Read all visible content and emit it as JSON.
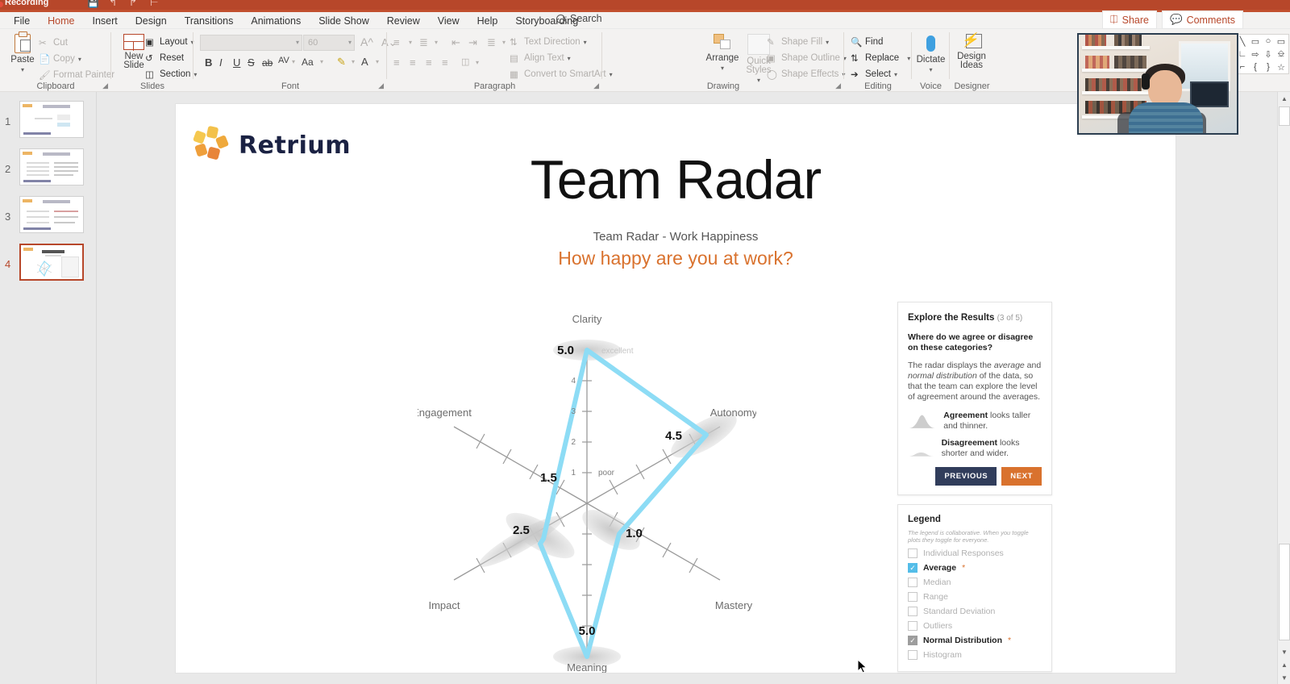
{
  "titlebar": {
    "recording_label": "Recording",
    "qat_icons": [
      "save-icon",
      "undo-icon",
      "redo-icon",
      "present-icon"
    ]
  },
  "ribbon": {
    "tabs": [
      {
        "label": "File",
        "active": false
      },
      {
        "label": "Home",
        "active": true
      },
      {
        "label": "Insert",
        "active": false
      },
      {
        "label": "Design",
        "active": false
      },
      {
        "label": "Transitions",
        "active": false
      },
      {
        "label": "Animations",
        "active": false
      },
      {
        "label": "Slide Show",
        "active": false
      },
      {
        "label": "Review",
        "active": false
      },
      {
        "label": "View",
        "active": false
      },
      {
        "label": "Help",
        "active": false
      },
      {
        "label": "Storyboarding",
        "active": false
      }
    ],
    "search_label": "Search",
    "share_label": "Share",
    "comments_label": "Comments",
    "groups": {
      "clipboard": {
        "name": "Clipboard",
        "paste": "Paste",
        "cut": "Cut",
        "copy": "Copy",
        "format_painter": "Format Painter"
      },
      "slides": {
        "name": "Slides",
        "new_slide_line1": "New",
        "new_slide_line2": "Slide",
        "layout": "Layout",
        "reset": "Reset",
        "section": "Section"
      },
      "font": {
        "name": "Font",
        "font_family_value": "",
        "font_size_value": "60",
        "bold": "B",
        "italic": "I",
        "underline": "U",
        "strikethrough": "S",
        "shadow": "ab",
        "spacing": "AV",
        "case": "Aa",
        "grow": "A",
        "shrink": "A",
        "clear": "A"
      },
      "paragraph": {
        "name": "Paragraph",
        "text_direction": "Text Direction",
        "align_text": "Align Text",
        "convert_smartart": "Convert to SmartArt"
      },
      "drawing": {
        "name": "Drawing",
        "arrange": "Arrange",
        "quick_styles_line1": "Quick",
        "quick_styles_line2": "Styles",
        "shape_fill": "Shape Fill",
        "shape_outline": "Shape Outline",
        "shape_effects": "Shape Effects",
        "shapes": [
          "A",
          "\\",
          "\\",
          "▭",
          "◯",
          "▢",
          "△",
          "⌐",
          "⌐",
          "⇨",
          "⇩",
          "⌒",
          "ℓ",
          "⌒",
          "⌒",
          "{",
          "}",
          "☆"
        ]
      },
      "editing": {
        "name": "Editing",
        "find": "Find",
        "replace": "Replace",
        "select": "Select"
      },
      "voice": {
        "name": "Voice",
        "dictate": "Dictate"
      },
      "designer": {
        "name": "Designer",
        "design_line1": "Design",
        "design_line2": "Ideas"
      }
    }
  },
  "thumbnails": [
    {
      "number": "1",
      "selected": false
    },
    {
      "number": "2",
      "selected": false
    },
    {
      "number": "3",
      "selected": false
    },
    {
      "number": "4",
      "selected": true
    }
  ],
  "slide": {
    "brand": "Retrium",
    "title": "Team Radar",
    "subtitle": "Team Radar - Work Happiness",
    "question": "How happy are you at work?"
  },
  "explore_panel": {
    "heading": "Explore the Results",
    "counter": "(3 of 5)",
    "question": "Where do we agree or disagree on these categories?",
    "body_1": "The radar displays the ",
    "body_em1": "average",
    "body_2": " and ",
    "body_em2": "normal distribution",
    "body_3": " of the data, so that the team can explore the level of agreement around the averages.",
    "agreement_bold": "Agreement",
    "agreement_rest": " looks taller and thinner.",
    "disagreement_bold": "Disagreement",
    "disagreement_rest": " looks shorter and wider.",
    "previous_label": "PREVIOUS",
    "next_label": "NEXT"
  },
  "legend_panel": {
    "heading": "Legend",
    "note": "The legend is collaborative. When you toggle plots they toggle for everyone.",
    "items": [
      {
        "label": "Individual Responses",
        "checked": false,
        "state": "off",
        "starred": false
      },
      {
        "label": "Average",
        "checked": true,
        "state": "blue",
        "starred": true
      },
      {
        "label": "Median",
        "checked": false,
        "state": "off",
        "starred": false
      },
      {
        "label": "Range",
        "checked": false,
        "state": "off",
        "starred": false
      },
      {
        "label": "Standard Deviation",
        "checked": false,
        "state": "off",
        "starred": false
      },
      {
        "label": "Outliers",
        "checked": false,
        "state": "off",
        "starred": false
      },
      {
        "label": "Normal Distribution",
        "checked": true,
        "state": "gray",
        "starred": true
      },
      {
        "label": "Histogram",
        "checked": false,
        "state": "off",
        "starred": false
      }
    ],
    "star_glyph": "*"
  },
  "colors": {
    "accent_orange": "#d9722e",
    "ribbon_red": "#b7472a",
    "radar_line": "#8ddcf5",
    "navy_button": "#313d5b",
    "checkbox_blue": "#54bde8",
    "distribution_gray": "#c9c9c9"
  },
  "chart_data": {
    "type": "radar",
    "title": "Team Radar - Work Happiness",
    "categories": [
      "Clarity",
      "Autonomy",
      "Mastery",
      "Meaning",
      "Impact",
      "Engagement"
    ],
    "series": [
      {
        "name": "Average",
        "values": [
          5.0,
          4.5,
          1.0,
          5.0,
          2.5,
          1.5
        ]
      }
    ],
    "value_labels": [
      "5.0",
      "4.5",
      "1.0",
      "5.0",
      "2.5",
      "1.5"
    ],
    "axis_ticks": [
      1,
      2,
      3,
      4,
      5
    ],
    "tick_labels": [
      "1",
      "2",
      "3",
      "4",
      "5"
    ],
    "scale_low_label": "poor",
    "scale_high_label": "excellent",
    "rlim": [
      0,
      5
    ],
    "grid": false,
    "legend_position": "right-panel",
    "notes": "Normal-distribution lobes drawn in grey around each average point"
  }
}
